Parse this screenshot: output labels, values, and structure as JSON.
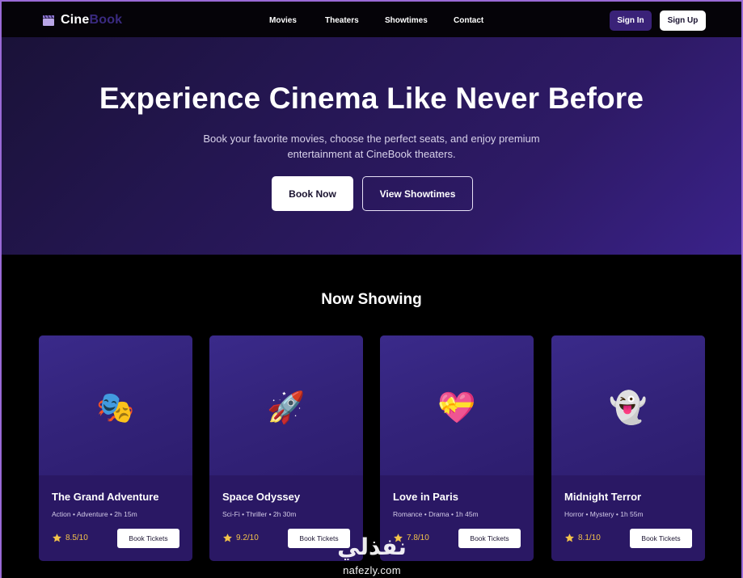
{
  "brand": {
    "name_part1": "Cine",
    "name_part2": "Book",
    "logo_icon": "clapperboard-icon"
  },
  "nav": {
    "links": [
      "Movies",
      "Theaters",
      "Showtimes",
      "Contact"
    ],
    "sign_in": "Sign In",
    "sign_up": "Sign Up"
  },
  "hero": {
    "title": "Experience Cinema Like Never Before",
    "subtitle": "Book your favorite movies, choose the perfect seats, and enjoy premium entertainment at CineBook theaters.",
    "book_now": "Book Now",
    "view_showtimes": "View Showtimes"
  },
  "now_showing": {
    "title": "Now Showing",
    "movies": [
      {
        "emoji": "🎭",
        "icon": "theater-masks-icon",
        "title": "The Grand Adventure",
        "meta": "Action • Adventure • 2h 15m",
        "rating": "8.5/10",
        "button": "Book Tickets"
      },
      {
        "emoji": "🚀",
        "icon": "rocket-icon",
        "title": "Space Odyssey",
        "meta": "Sci-Fi • Thriller • 2h 30m",
        "rating": "9.2/10",
        "button": "Book Tickets"
      },
      {
        "emoji": "💝",
        "icon": "heart-gift-icon",
        "title": "Love in Paris",
        "meta": "Romance • Drama • 1h 45m",
        "rating": "7.8/10",
        "button": "Book Tickets"
      },
      {
        "emoji": "👻",
        "icon": "ghost-icon",
        "title": "Midnight Terror",
        "meta": "Horror • Mystery • 1h 55m",
        "rating": "8.1/10",
        "button": "Book Tickets"
      }
    ]
  },
  "watermark": {
    "arabic": "نفذلي",
    "url": "nafezly.com"
  },
  "colors": {
    "accent": "#3a2278",
    "hero_bg": "#241651",
    "card_bg": "#2a1864",
    "star": "#f3c34a"
  }
}
